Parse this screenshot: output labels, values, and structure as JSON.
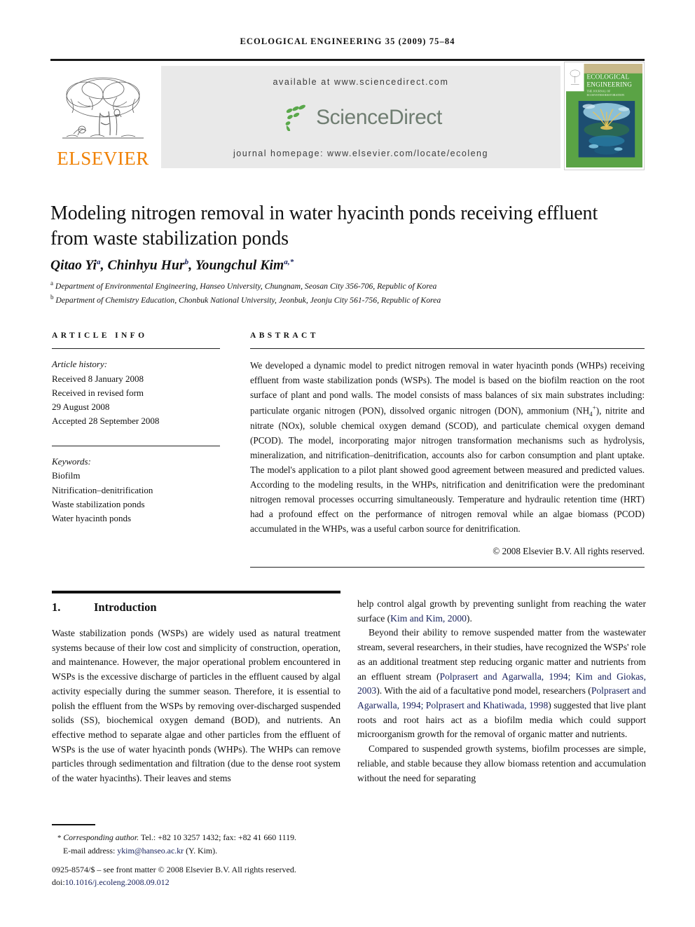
{
  "running_head": "ECOLOGICAL ENGINEERING 35 (2009) 75–84",
  "masthead": {
    "publisher_name": "ELSEVIER",
    "available_at": "available at www.sciencedirect.com",
    "sciencedirect_wordmark": "ScienceDirect",
    "journal_homepage": "journal homepage: www.elsevier.com/locate/ecoleng",
    "cover": {
      "line1": "ECOLOGICAL",
      "line2": "ENGINEERING",
      "subtitle1": "THE JOURNAL OF",
      "subtitle2": "ECOSYSTEM RESTORATION",
      "cover_green": "#5aa345",
      "cover_tan": "#c8b98a"
    },
    "elsevier_orange": "#F08000",
    "banner_bg": "#e9e9e9"
  },
  "article": {
    "title": "Modeling nitrogen removal in water hyacinth ponds receiving effluent from waste stabilization ponds",
    "authors_html": "Qitao Yi<sup>a</sup>, Chinhyu Hur<sup>b</sup>, Youngchul Kim<sup>a,</sup><sup>*</sup>",
    "affiliation_a": "Department of Environmental Engineering, Hanseo University, Chungnam, Seosan City 356-706, Republic of Korea",
    "affiliation_b": "Department of Chemistry Education, Chonbuk National University, Jeonbuk, Jeonju City 561-756, Republic of Korea"
  },
  "article_info": {
    "heading": "ARTICLE INFO",
    "history_label": "Article history:",
    "history": [
      "Received 8 January 2008",
      "Received in revised form",
      "29 August 2008",
      "Accepted 28 September 2008"
    ],
    "keywords_label": "Keywords:",
    "keywords": [
      "Biofilm",
      "Nitrification–denitrification",
      "Waste stabilization ponds",
      "Water hyacinth ponds"
    ]
  },
  "abstract": {
    "heading": "ABSTRACT",
    "text_html": "We developed a dynamic model to predict nitrogen removal in water hyacinth ponds (WHPs) receiving effluent from waste stabilization ponds (WSPs). The model is based on the biofilm reaction on the root surface of plant and pond walls. The model consists of mass balances of six main substrates including: particulate organic nitrogen (PON), dissolved organic nitrogen (DON), ammonium (NH<sub>4</sub><sup>+</sup>), nitrite and nitrate (NOx), soluble chemical oxygen demand (SCOD), and particulate chemical oxygen demand (PCOD). The model, incorporating major nitrogen transformation mechanisms such as hydrolysis, mineralization, and nitrification–denitrification, accounts also for carbon consumption and plant uptake. The model's application to a pilot plant showed good agreement between measured and predicted values. According to the modeling results, in the WHPs, nitrification and denitrification were the predominant nitrogen removal processes occurring simultaneously. Temperature and hydraulic retention time (HRT) had a profound effect on the performance of nitrogen removal while an algae biomass (PCOD) accumulated in the WHPs, was a useful carbon source for denitrification.",
    "copyright": "© 2008 Elsevier B.V. All rights reserved."
  },
  "section": {
    "number": "1.",
    "title": "Introduction"
  },
  "body": {
    "left_paragraph_1": "Waste stabilization ponds (WSPs) are widely used as natural treatment systems because of their low cost and simplicity of construction, operation, and maintenance. However, the major operational problem encountered in WSPs is the excessive discharge of particles in the effluent caused by algal activity especially during the summer season. Therefore, it is essential to polish the effluent from the WSPs by removing over-discharged suspended solids (SS), biochemical oxygen demand (BOD), and nutrients. An effective method to separate algae and other particles from the effluent of WSPs is the use of water hyacinth ponds (WHPs). The WHPs can remove particles through sedimentation and filtration (due to the dense root system of the water hyacinths). Their leaves and stems",
    "right_paragraph_1_html": "help control algal growth by preventing sunlight from reaching the water surface (<span class=\"cite\">Kim and Kim, 2000</span>).",
    "right_paragraph_2_html": "Beyond their ability to remove suspended matter from the wastewater stream, several researchers, in their studies, have recognized the WSPs' role as an additional treatment step reducing organic matter and nutrients from an effluent stream (<span class=\"cite\">Polprasert and Agarwalla, 1994; Kim and Giokas, 2003</span>). With the aid of a facultative pond model, researchers (<span class=\"cite\">Polprasert and Agarwalla, 1994; Polprasert and Khatiwada, 1998</span>) suggested that live plant roots and root hairs act as a biofilm media which could support microorganism growth for the removal of organic matter and nutrients.",
    "right_paragraph_3_html": "Compared to suspended growth systems, biofilm processes are simple, reliable, and stable because they allow biomass retention and accumulation without the need for separating"
  },
  "footnote": {
    "corresponding_html": "<span class=\"fn-corr\">Corresponding author.</span> Tel.: +82 10 3257 1432; fax: +82 41 660 1119.",
    "email_html": "E-mail address: <span class=\"mail\">ykim@hanseo.ac.kr</span> (Y. Kim).",
    "front_matter": "0925-8574/$ – see front matter © 2008 Elsevier B.V. All rights reserved.",
    "doi_prefix": "doi:",
    "doi_value": "10.1016/j.ecoleng.2008.09.012"
  }
}
